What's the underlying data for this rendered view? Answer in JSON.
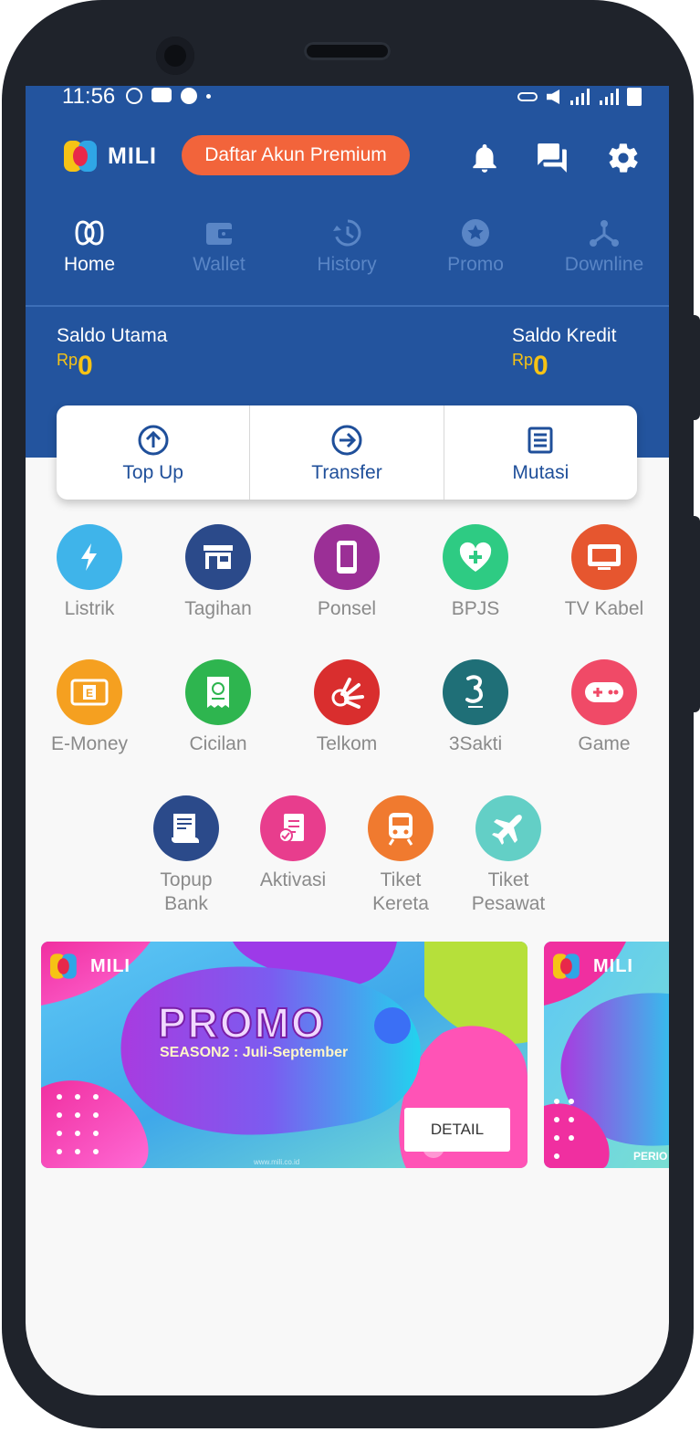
{
  "status_bar": {
    "time": "11:56"
  },
  "header": {
    "brand": "MILI",
    "premium_button": "Daftar Akun Premium",
    "tabs": [
      {
        "label": "Home",
        "icon": "mili-icon",
        "active": true
      },
      {
        "label": "Wallet",
        "icon": "wallet-icon",
        "active": false
      },
      {
        "label": "History",
        "icon": "history-icon",
        "active": false
      },
      {
        "label": "Promo",
        "icon": "star-icon",
        "active": false
      },
      {
        "label": "Downline",
        "icon": "network-icon",
        "active": false
      }
    ]
  },
  "balance": {
    "main_label": "Saldo Utama",
    "main_currency": "Rp",
    "main_value": "0",
    "credit_label": "Saldo Kredit",
    "credit_currency": "Rp",
    "credit_value": "0"
  },
  "actions": [
    {
      "label": "Top Up",
      "icon": "upload-circle-icon"
    },
    {
      "label": "Transfer",
      "icon": "arrow-right-circle-icon"
    },
    {
      "label": "Mutasi",
      "icon": "list-icon"
    }
  ],
  "menu": [
    {
      "label": "Listrik",
      "icon": "lightning-icon",
      "color": "#3fb4ea"
    },
    {
      "label": "Tagihan",
      "icon": "store-icon",
      "color": "#2b4a8a"
    },
    {
      "label": "Ponsel",
      "icon": "phone-icon",
      "color": "#9b2f96"
    },
    {
      "label": "BPJS",
      "icon": "heart-plus-icon",
      "color": "#2ecb83"
    },
    {
      "label": "TV Kabel",
      "icon": "tv-icon",
      "color": "#e6562f"
    },
    {
      "label": "E-Money",
      "icon": "emoney-card-icon",
      "color": "#f5a020"
    },
    {
      "label": "Cicilan",
      "icon": "receipt-icon",
      "color": "#2eb54f"
    },
    {
      "label": "Telkom",
      "icon": "telkom-icon",
      "color": "#d92e2e"
    },
    {
      "label": "3Sakti",
      "icon": "three-logo-icon",
      "color": "#1f6f77"
    },
    {
      "label": "Game",
      "icon": "gamepad-icon",
      "color": "#f04a67"
    },
    {
      "label": "Topup\nBank",
      "icon": "bank-document-icon",
      "color": "#2b4a8a"
    },
    {
      "label": "Aktivasi",
      "icon": "activation-doc-icon",
      "color": "#e83d8d"
    },
    {
      "label": "Tiket\nKereta",
      "icon": "train-icon",
      "color": "#f07a2f"
    },
    {
      "label": "Tiket\nPesawat",
      "icon": "airplane-icon",
      "color": "#63cfc6"
    }
  ],
  "banners": [
    {
      "brand": "MILI",
      "title": "PROMO",
      "subtitle": "SEASON2 : Juli-September",
      "button": "DETAIL",
      "url": "www.mili.co.id"
    },
    {
      "brand": "MILI",
      "partial_footer": "PERIO"
    }
  ],
  "colors": {
    "primary": "#23549e",
    "accent": "#f2643b",
    "balance": "#f6c315"
  }
}
